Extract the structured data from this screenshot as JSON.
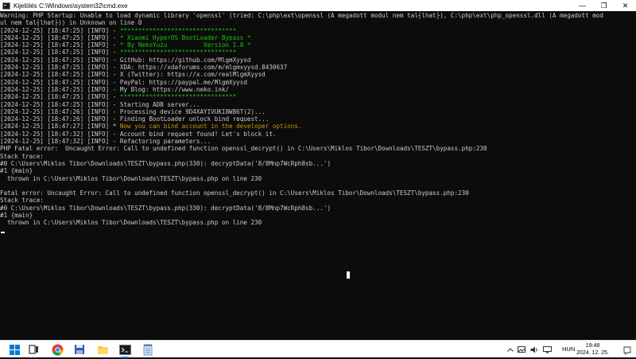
{
  "window": {
    "title": "Kijelölés C:\\Windows\\system32\\cmd.exe",
    "minimize": "—",
    "maximize": "❐",
    "close": "✕"
  },
  "console_lines": [
    {
      "text": "Warning: PHP Startup: Unable to load dynamic library 'openssl' (tried: C:\\php\\ext\\openssl (A megadott modul nem tal┤lhat├), C:\\php\\ext\\php_openssl.dll (A megadott mod",
      "color": "#cccccc"
    },
    {
      "text": "ul nem tal┤lhat├)) in Unknown on line 0",
      "color": "#cccccc"
    },
    {
      "prefix": "[2024-12-25] [18:47:25] [INFO] - ",
      "text": "********************************",
      "color": "#16c60c"
    },
    {
      "prefix": "[2024-12-25] [18:47:25] [INFO] - ",
      "text": "* Xiaomi HyperOS BootLoader Bypass *",
      "color": "#16c60c"
    },
    {
      "prefix": "[2024-12-25] [18:47:25] [INFO] - ",
      "text": "* By NekoYuzu          Version 1.0 *",
      "color": "#16c60c"
    },
    {
      "prefix": "[2024-12-25] [18:47:25] [INFO] - ",
      "text": "********************************",
      "color": "#16c60c"
    },
    {
      "prefix": "[2024-12-25] [18:47:25] [INFO] - ",
      "text": "GitHub: https://github.com/MlgmXyysd",
      "color": "#cccccc"
    },
    {
      "prefix": "[2024-12-25] [18:47:25] [INFO] - ",
      "text": "XDA: https://xdaforums.com/m/mlgmxyysd.8430637",
      "color": "#cccccc"
    },
    {
      "prefix": "[2024-12-25] [18:47:25] [INFO] - ",
      "text": "X (Twitter): https://x.com/realMlgmXyysd",
      "color": "#cccccc"
    },
    {
      "prefix": "[2024-12-25] [18:47:25] [INFO] - ",
      "text": "PayPal: https://paypal.me/MlgmXyysd",
      "color": "#cccccc"
    },
    {
      "prefix": "[2024-12-25] [18:47:25] [INFO] - ",
      "text": "My Blog: https://www.neko.ink/",
      "color": "#cccccc"
    },
    {
      "prefix": "[2024-12-25] [18:47:25] [INFO] - ",
      "text": "********************************",
      "color": "#16c60c"
    },
    {
      "prefix": "[2024-12-25] [18:47:25] [INFO] - ",
      "text": "Starting ADB server...",
      "color": "#cccccc"
    },
    {
      "prefix": "[2024-12-25] [18:47:26] [INFO] - ",
      "text": "Processing device 9D4XAYIVUKI8W86T(2)...",
      "color": "#cccccc"
    },
    {
      "prefix": "[2024-12-25] [18:47:26] [INFO] - ",
      "text": "Finding BootLoader unlock bind request...",
      "color": "#cccccc"
    },
    {
      "prefix": "[2024-12-25] [18:47:27] [INFO] * ",
      "text": "Now you can bind account in the developer options.",
      "color": "#c19c00"
    },
    {
      "prefix": "[2024-12-25] [18:47:32] [INFO] - ",
      "text": "Account bind request found! Let's block it.",
      "color": "#cccccc"
    },
    {
      "prefix": "[2024-12-25] [18:47:32] [INFO] - ",
      "text": "Refactoring parameters...",
      "color": "#cccccc"
    },
    {
      "text": "PHP Fatal error:  Uncaught Error: Call to undefined function openssl_decrypt() in C:\\Users\\Miklos Tibor\\Downloads\\TESZT\\bypass.php:230",
      "color": "#cccccc"
    },
    {
      "text": "Stack trace:",
      "color": "#cccccc"
    },
    {
      "text": "#0 C:\\Users\\Miklos Tibor\\Downloads\\TESZT\\bypass.php(330): decryptData('8/8Mnp7WcRph8sb...')",
      "color": "#cccccc"
    },
    {
      "text": "#1 {main}",
      "color": "#cccccc"
    },
    {
      "text": "  thrown in C:\\Users\\Miklos Tibor\\Downloads\\TESZT\\bypass.php on line 230",
      "color": "#cccccc"
    },
    {
      "text": "",
      "color": "#cccccc"
    },
    {
      "text": "Fatal error: Uncaught Error: Call to undefined function openssl_decrypt() in C:\\Users\\Miklos Tibor\\Downloads\\TESZT\\bypass.php:230",
      "color": "#cccccc"
    },
    {
      "text": "Stack trace:",
      "color": "#cccccc"
    },
    {
      "text": "#0 C:\\Users\\Miklos Tibor\\Downloads\\TESZT\\bypass.php(330): decryptData('8/8Mnp7WcRph8sb...')",
      "color": "#cccccc"
    },
    {
      "text": "#1 {main}",
      "color": "#cccccc"
    },
    {
      "text": "  thrown in C:\\Users\\Miklos Tibor\\Downloads\\TESZT\\bypass.php on line 230",
      "color": "#cccccc"
    }
  ],
  "taskbar": {
    "items": [
      "windows-start-icon",
      "task-view-icon",
      "chrome-icon",
      "save-disk-icon",
      "file-explorer-icon",
      "command-prompt-icon",
      "notepad-icon"
    ],
    "active": "command-prompt-icon",
    "tray_icons": [
      "chevron-up-icon",
      "image-icon",
      "volume-icon",
      "network-icon"
    ],
    "language": "HUN",
    "time": "19:48",
    "date": "2024. 12. 25."
  }
}
